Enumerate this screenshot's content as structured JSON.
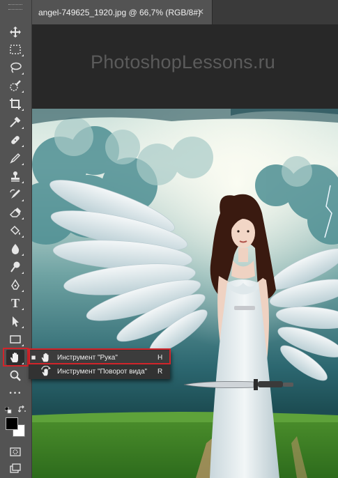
{
  "document": {
    "tab_title": "angel-749625_1920.jpg @ 66,7% (RGB/8#)",
    "close_glyph": "✕"
  },
  "watermark": "PhotoshopLessons.ru",
  "toolbar": {
    "tools": [
      {
        "name": "move-tool",
        "icon": "move-icon"
      },
      {
        "name": "marquee-tool",
        "icon": "rect-marquee-icon"
      },
      {
        "name": "lasso-tool",
        "icon": "lasso-icon"
      },
      {
        "name": "quick-select-tool",
        "icon": "quick-select-icon"
      },
      {
        "name": "crop-tool",
        "icon": "crop-icon"
      },
      {
        "name": "eyedropper-tool",
        "icon": "eyedropper-icon"
      },
      {
        "name": "healing-tool",
        "icon": "bandage-icon"
      },
      {
        "name": "brush-tool",
        "icon": "brush-icon"
      },
      {
        "name": "stamp-tool",
        "icon": "stamp-icon"
      },
      {
        "name": "history-brush-tool",
        "icon": "history-brush-icon"
      },
      {
        "name": "eraser-tool",
        "icon": "eraser-icon"
      },
      {
        "name": "paint-bucket-tool",
        "icon": "bucket-icon"
      },
      {
        "name": "blur-tool",
        "icon": "drop-icon"
      },
      {
        "name": "dodge-tool",
        "icon": "dodge-icon"
      },
      {
        "name": "pen-tool",
        "icon": "pen-icon"
      },
      {
        "name": "type-tool",
        "icon": "type-icon"
      },
      {
        "name": "path-select-tool",
        "icon": "arrow-icon"
      },
      {
        "name": "shape-tool",
        "icon": "rectangle-icon"
      },
      {
        "name": "hand-tool",
        "icon": "hand-icon"
      },
      {
        "name": "zoom-tool",
        "icon": "zoom-icon"
      },
      {
        "name": "edit-toolbar",
        "icon": "more-icon"
      }
    ],
    "type_glyph": "T",
    "more_glyph": "•••"
  },
  "flyout": {
    "items": [
      {
        "label": "Инструмент \"Рука\"",
        "shortcut": "H",
        "selected": true,
        "icon": "hand-icon"
      },
      {
        "label": "Инструмент \"Поворот вида\"",
        "shortcut": "R",
        "selected": false,
        "icon": "rotate-view-icon"
      }
    ],
    "selected_mark": "■"
  },
  "colors": {
    "foreground": "#000000",
    "background": "#ffffff",
    "highlight": "#d2242a"
  }
}
